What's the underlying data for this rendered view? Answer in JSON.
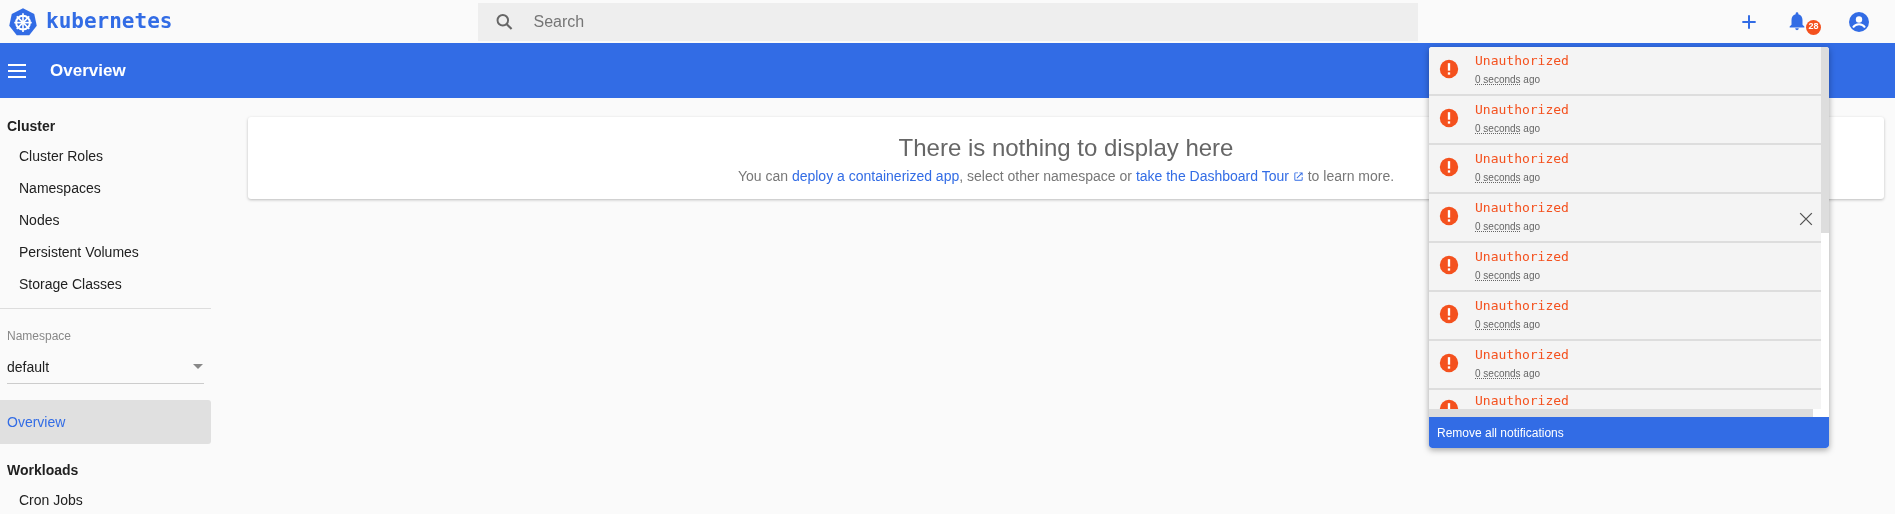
{
  "header": {
    "brand": "kubernetes",
    "search": {
      "placeholder": "Search"
    },
    "notification_count": "28"
  },
  "toolbar": {
    "title": "Overview"
  },
  "sidebar": {
    "sections": [
      {
        "kind": "group",
        "title": "Cluster",
        "items": [
          {
            "label": "Cluster Roles"
          },
          {
            "label": "Namespaces"
          },
          {
            "label": "Nodes"
          },
          {
            "label": "Persistent Volumes"
          },
          {
            "label": "Storage Classes"
          }
        ]
      },
      {
        "kind": "namespace",
        "label": "Namespace",
        "value": "default"
      },
      {
        "kind": "link",
        "label": "Overview",
        "selected": true
      },
      {
        "kind": "group",
        "title": "Workloads",
        "items": [
          {
            "label": "Cron Jobs"
          }
        ]
      }
    ]
  },
  "empty_card": {
    "title": "There is nothing to display here",
    "message": [
      {
        "kind": "text",
        "text": "You can "
      },
      {
        "kind": "link",
        "text": "deploy a containerized app",
        "external": false
      },
      {
        "kind": "text",
        "text": ", select other namespace or "
      },
      {
        "kind": "link",
        "text": "take the Dashboard Tour",
        "external": true
      },
      {
        "kind": "text",
        "text": " to learn more."
      }
    ]
  },
  "notifications": {
    "items": [
      {
        "message": "Unauthorized",
        "time": "0 seconds",
        "suffix": "ago",
        "hovered": false
      },
      {
        "message": "Unauthorized",
        "time": "0 seconds",
        "suffix": "ago",
        "hovered": false
      },
      {
        "message": "Unauthorized",
        "time": "0 seconds",
        "suffix": "ago",
        "hovered": false
      },
      {
        "message": "Unauthorized",
        "time": "0 seconds",
        "suffix": "ago",
        "hovered": true
      },
      {
        "message": "Unauthorized",
        "time": "0 seconds",
        "suffix": "ago",
        "hovered": false
      },
      {
        "message": "Unauthorized",
        "time": "0 seconds",
        "suffix": "ago",
        "hovered": false
      },
      {
        "message": "Unauthorized",
        "time": "0 seconds",
        "suffix": "ago",
        "hovered": false
      },
      {
        "message": "Unauthorized"
      }
    ],
    "remove_all": "Remove all notifications"
  }
}
